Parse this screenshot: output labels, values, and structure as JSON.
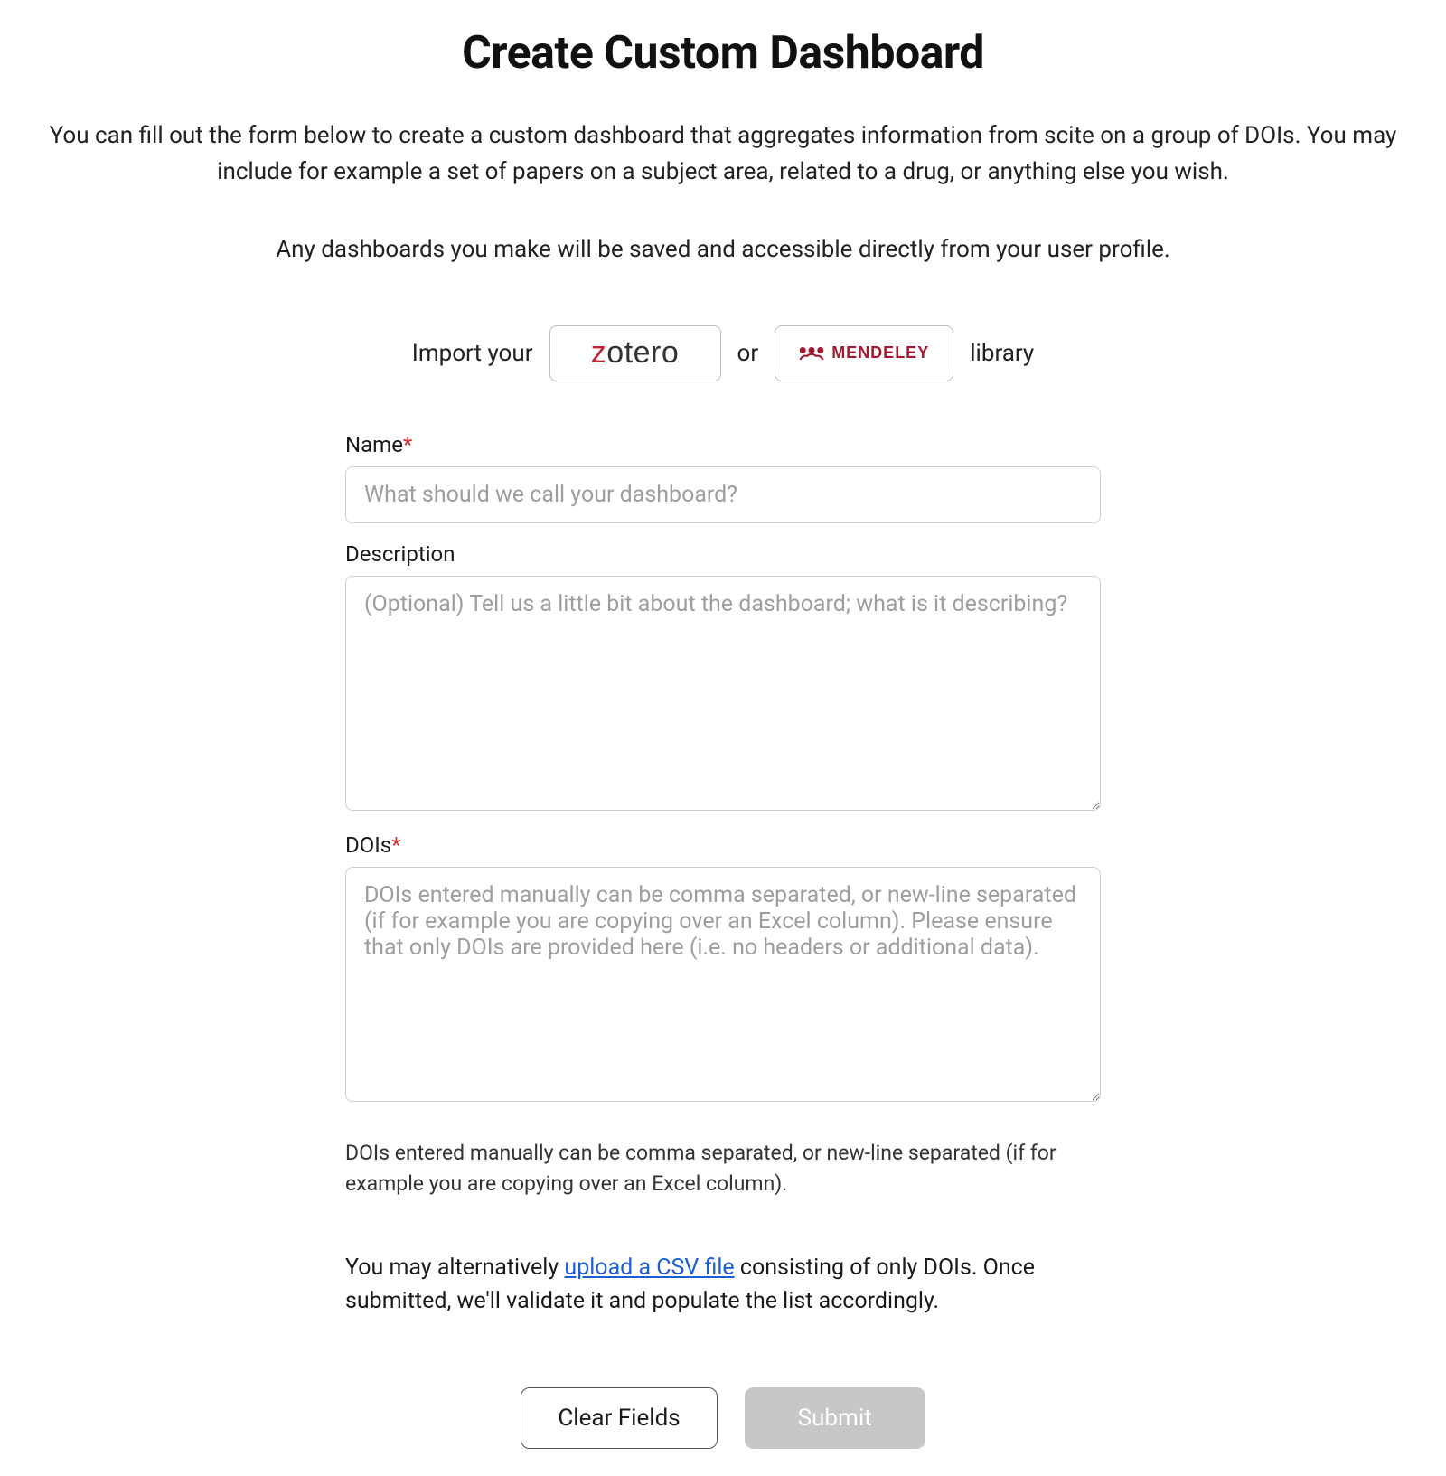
{
  "header": {
    "title": "Create Custom Dashboard"
  },
  "intro": {
    "paragraph1": "You can fill out the form below to create a custom dashboard that aggregates information from scite on a group of DOIs. You may include for example a set of papers on a subject area, related to a drug, or anything else you wish.",
    "paragraph2": "Any dashboards you make will be saved and accessible directly from your user profile."
  },
  "import": {
    "prefix": "Import your",
    "separator": "or",
    "suffix": "library",
    "zotero_label": "zotero",
    "mendeley_label": "MENDELEY"
  },
  "form": {
    "name": {
      "label": "Name",
      "required_mark": "*",
      "placeholder": "What should we call your dashboard?",
      "value": ""
    },
    "description": {
      "label": "Description",
      "placeholder": "(Optional) Tell us a little bit about the dashboard; what is it describing?",
      "value": ""
    },
    "dois": {
      "label": "DOIs",
      "required_mark": "*",
      "placeholder": "DOIs entered manually can be comma separated, or new-line separated (if for example you are copying over an Excel column). Please ensure that only DOIs are provided here (i.e. no headers or additional data).",
      "value": "",
      "help_text": "DOIs entered manually can be comma separated, or new-line separated (if for example you are copying over an Excel column)."
    },
    "csv_help": {
      "prefix": "You may alternatively ",
      "link_text": "upload a CSV file",
      "suffix": " consisting of only DOIs. Once submitted, we'll validate it and populate the list accordingly."
    }
  },
  "buttons": {
    "clear": "Clear Fields",
    "submit": "Submit"
  }
}
